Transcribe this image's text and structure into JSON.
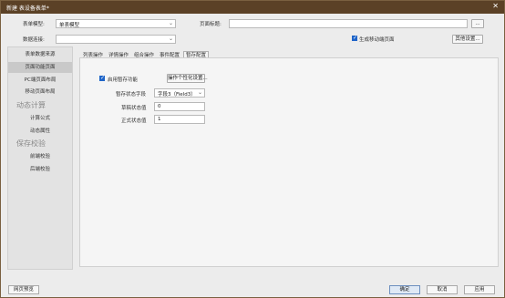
{
  "window": {
    "title": "新建 表设备表单*",
    "close_icon": "✕"
  },
  "top": {
    "form_model_label": "表单模型:",
    "form_model_value": "单表模型",
    "data_connection_label": "数据连接:",
    "data_connection_value": "",
    "page_title_label": "页面标题:",
    "page_title_value": "",
    "ellipsis_button": "...",
    "generate_mobile_label": "生成移动端页面",
    "generate_mobile_checked": true,
    "other_settings_button": "其他设置..."
  },
  "sidebar": {
    "items": [
      {
        "label": "表单数据来源",
        "active": false
      },
      {
        "label": "页面功能页面",
        "active": true
      },
      {
        "label": "PC端页面布局",
        "active": false
      },
      {
        "label": "移动页面布局",
        "active": false
      }
    ],
    "group_dynamic": "动态计算",
    "dynamic_items": [
      "计算公式",
      "动态属性"
    ],
    "group_save": "保存校验",
    "save_items": [
      "前端校验",
      "后端校验"
    ]
  },
  "tabs": [
    "列表操作",
    "详情操作",
    "组合操作",
    "事件配置",
    "暂存配置"
  ],
  "active_tab": "暂存配置",
  "staging": {
    "enable_label": "启用暂存功能",
    "enable_checked": true,
    "personalize_button": "操作个性化设置...",
    "status_field_label": "暂存状态字段",
    "status_field_value": "字段3（Field3）",
    "draft_value_label": "草稿状态值",
    "draft_value": "0",
    "formal_value_label": "正式状态值",
    "formal_value": "1"
  },
  "footer": {
    "preview_button": "网页预览",
    "ok_button": "确定",
    "cancel_button": "取消",
    "apply_button": "应用"
  }
}
